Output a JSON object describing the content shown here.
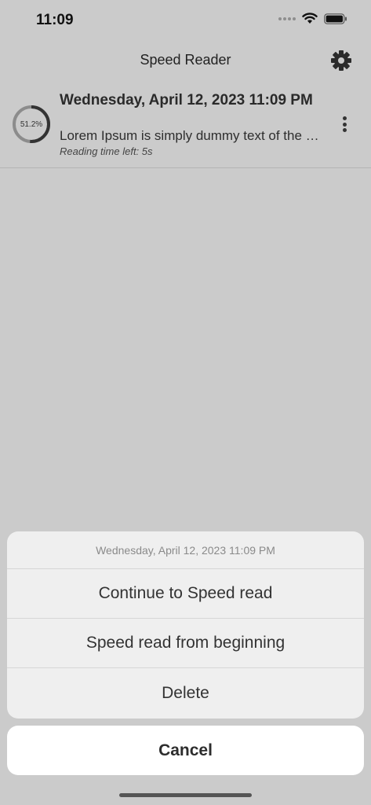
{
  "status_bar": {
    "time": "11:09"
  },
  "nav": {
    "title": "Speed Reader"
  },
  "reading_item": {
    "progress_percent": 51.2,
    "progress_label": "51.2%",
    "title": "Wednesday, April 12, 2023 11:09 PM",
    "excerpt": "Lorem Ipsum is simply dummy text of the printing and typesetting industry",
    "time_left": "Reading time left: 5s"
  },
  "action_sheet": {
    "header": "Wednesday, April 12, 2023 11:09 PM",
    "continue_label": "Continue to Speed read",
    "beginning_label": "Speed read from beginning",
    "delete_label": "Delete",
    "cancel_label": "Cancel"
  },
  "colors": {
    "background": "#cbcbcb",
    "sheet": "#efefef",
    "progress_track": "#8c8c8c",
    "progress_fill": "#333333"
  },
  "icons": {
    "settings": "gear-icon",
    "more": "more-vertical-icon",
    "wifi": "wifi-icon",
    "battery": "battery-icon"
  }
}
